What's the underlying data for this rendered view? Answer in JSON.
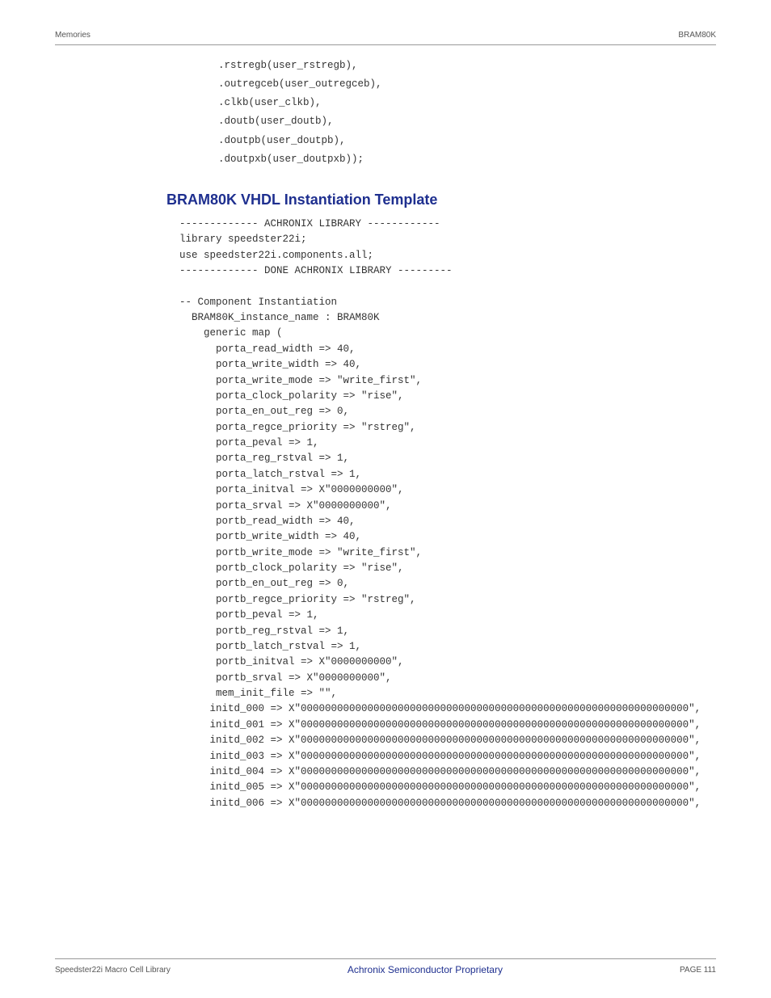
{
  "header": {
    "left": "Memories",
    "right": "BRAM80K"
  },
  "code_top": ".rstregb(user_rstregb),\n.outregceb(user_outregceb),\n.clkb(user_clkb),\n.doutb(user_doutb),\n.doutpb(user_doutpb),\n.doutpxb(user_doutpxb));",
  "section_title": "BRAM80K VHDL Instantiation Template",
  "code_main": "------------- ACHRONIX LIBRARY ------------\nlibrary speedster22i;\nuse speedster22i.components.all;\n------------- DONE ACHRONIX LIBRARY ---------\n\n-- Component Instantiation\n  BRAM80K_instance_name : BRAM80K\n    generic map (\n      porta_read_width => 40,\n      porta_write_width => 40,\n      porta_write_mode => \"write_first\",\n      porta_clock_polarity => \"rise\",\n      porta_en_out_reg => 0,\n      porta_regce_priority => \"rstreg\",\n      porta_peval => 1,\n      porta_reg_rstval => 1,\n      porta_latch_rstval => 1,\n      porta_initval => X\"0000000000\",\n      porta_srval => X\"0000000000\",\n      portb_read_width => 40,\n      portb_write_width => 40,\n      portb_write_mode => \"write_first\",\n      portb_clock_polarity => \"rise\",\n      portb_en_out_reg => 0,\n      portb_regce_priority => \"rstreg\",\n      portb_peval => 1,\n      portb_reg_rstval => 1,\n      portb_latch_rstval => 1,\n      portb_initval => X\"0000000000\",\n      portb_srval => X\"0000000000\",\n      mem_init_file => \"\",\n     initd_000 => X\"0000000000000000000000000000000000000000000000000000000000000000\",\n     initd_001 => X\"0000000000000000000000000000000000000000000000000000000000000000\",\n     initd_002 => X\"0000000000000000000000000000000000000000000000000000000000000000\",\n     initd_003 => X\"0000000000000000000000000000000000000000000000000000000000000000\",\n     initd_004 => X\"0000000000000000000000000000000000000000000000000000000000000000\",\n     initd_005 => X\"0000000000000000000000000000000000000000000000000000000000000000\",\n     initd_006 => X\"0000000000000000000000000000000000000000000000000000000000000000\",",
  "footer": {
    "left": "Speedster22i Macro Cell Library",
    "center": "Achronix Semiconductor Proprietary",
    "right": "PAGE 111"
  }
}
